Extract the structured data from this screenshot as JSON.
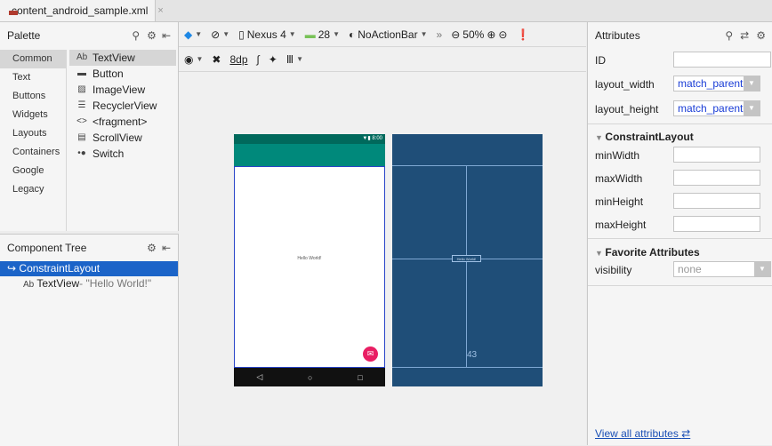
{
  "tab": {
    "filename": "content_android_sample.xml",
    "close": "×"
  },
  "palette": {
    "title": "Palette",
    "categories": [
      "Common",
      "Text",
      "Buttons",
      "Widgets",
      "Layouts",
      "Containers",
      "Google",
      "Legacy"
    ],
    "selected_category": "Common",
    "items": [
      {
        "icon": "Ab",
        "label": "TextView"
      },
      {
        "icon": "▬",
        "label": "Button"
      },
      {
        "icon": "▨",
        "label": "ImageView"
      },
      {
        "icon": "☰",
        "label": "RecyclerView"
      },
      {
        "icon": "<>",
        "label": "<fragment>"
      },
      {
        "icon": "▤",
        "label": "ScrollView"
      },
      {
        "icon": "•●",
        "label": "Switch"
      }
    ]
  },
  "component_tree": {
    "title": "Component Tree",
    "root": "ConstraintLayout",
    "child_icon": "Ab",
    "child": "TextView",
    "child_text": "- \"Hello World!\""
  },
  "toolbar": {
    "device": "Nexus 4",
    "api": "28",
    "theme": "NoActionBar",
    "more": "»",
    "zoom": "50%",
    "margin": "8dp"
  },
  "preview": {
    "status_time": "8:00",
    "hello_text": "Hello World!",
    "blueprint_label": "Hello World!",
    "blueprint_margin": "43"
  },
  "attributes": {
    "title": "Attributes",
    "id_label": "ID",
    "id_value": "",
    "layout_width_label": "layout_width",
    "layout_width_value": "match_parent",
    "layout_height_label": "layout_height",
    "layout_height_value": "match_parent",
    "constraint_section": "ConstraintLayout",
    "min_width_label": "minWidth",
    "max_width_label": "maxWidth",
    "min_height_label": "minHeight",
    "max_height_label": "maxHeight",
    "favorite_section": "Favorite Attributes",
    "visibility_label": "visibility",
    "visibility_value": "none",
    "view_all": "View all attributes"
  }
}
